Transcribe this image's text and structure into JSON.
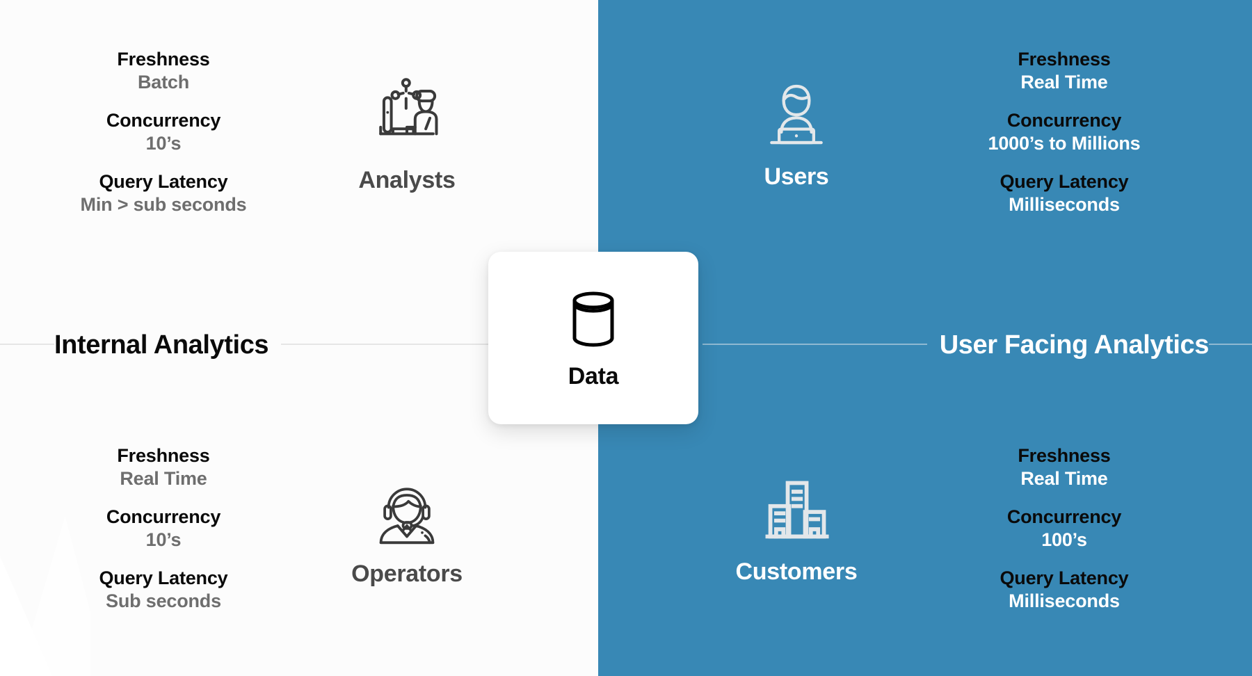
{
  "theme": {
    "blue": "#3888b5",
    "off_white": "#fcfcfc",
    "label_dark": "#0a0a0a",
    "value_gray": "#6e6e6e",
    "value_white": "#ffffff",
    "persona_gray": "#4a4a4a",
    "rule_light": "#e6e6e6",
    "rule_blue": "#8fb9d2"
  },
  "sections": {
    "left_title": "Internal Analytics",
    "right_title": "User Facing Analytics"
  },
  "center": {
    "label": "Data",
    "icon": "database-cylinder-icon"
  },
  "quadrants": {
    "analysts": {
      "persona_label": "Analysts",
      "persona_icon": "analyst-at-desk-icon",
      "stats": [
        {
          "label": "Freshness",
          "value": "Batch"
        },
        {
          "label": "Concurrency",
          "value": "10’s"
        },
        {
          "label": "Query Latency",
          "value": "Min > sub seconds"
        }
      ]
    },
    "operators": {
      "persona_label": "Operators",
      "persona_icon": "headset-operator-icon",
      "stats": [
        {
          "label": "Freshness",
          "value": "Real Time"
        },
        {
          "label": "Concurrency",
          "value": "10’s"
        },
        {
          "label": "Query Latency",
          "value": "Sub seconds"
        }
      ]
    },
    "users": {
      "persona_label": "Users",
      "persona_icon": "person-with-laptop-icon",
      "stats": [
        {
          "label": "Freshness",
          "value": "Real Time"
        },
        {
          "label": "Concurrency",
          "value": "1000’s to Millions"
        },
        {
          "label": "Query Latency",
          "value": "Milliseconds"
        }
      ]
    },
    "customers": {
      "persona_label": "Customers",
      "persona_icon": "office-buildings-icon",
      "stats": [
        {
          "label": "Freshness",
          "value": "Real Time"
        },
        {
          "label": "Concurrency",
          "value": "100’s"
        },
        {
          "label": "Query Latency",
          "value": "Milliseconds"
        }
      ]
    }
  }
}
